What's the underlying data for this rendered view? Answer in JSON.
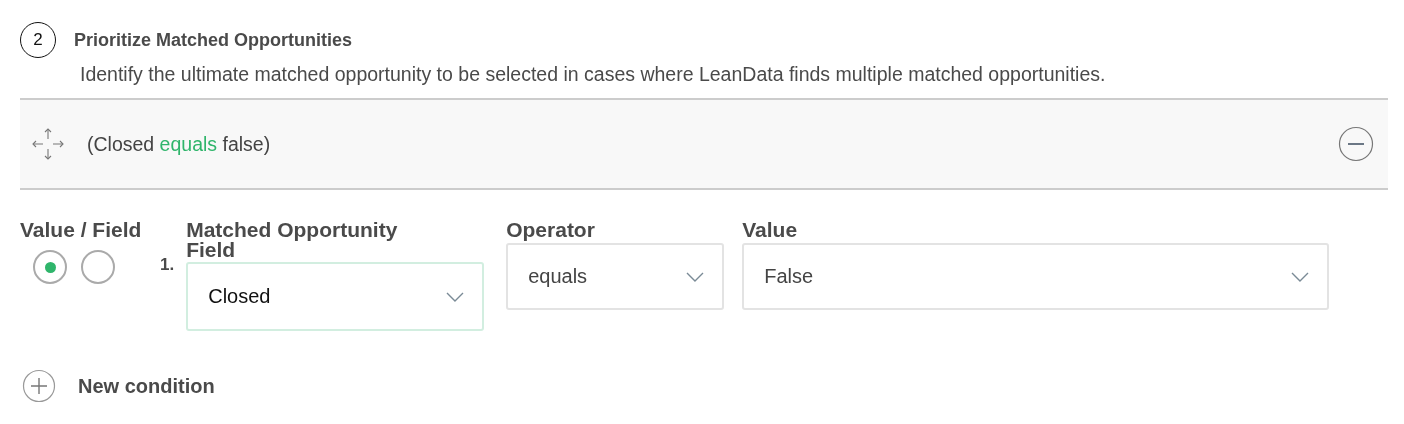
{
  "step": {
    "number": "2",
    "title": "Prioritize Matched Opportunities",
    "description": "Identify the ultimate matched opportunity to be selected in cases where LeanData finds multiple matched opportunities."
  },
  "rule": {
    "summary": [
      {
        "text": "(Closed",
        "kind": "plain"
      },
      {
        "text": "equals",
        "kind": "operator"
      },
      {
        "text": "false)",
        "kind": "plain"
      }
    ]
  },
  "condition": {
    "value_field_label": "Value / Field",
    "value_field_options": [
      {
        "selected": true
      },
      {
        "selected": false
      }
    ],
    "index": "1.",
    "field": {
      "label": "Matched Opportunity Field",
      "value": "Closed",
      "focused": true
    },
    "operator": {
      "label": "Operator",
      "value": "equals",
      "focused": false
    },
    "value": {
      "label": "Value",
      "value": "False",
      "focused": false
    }
  },
  "new_condition": "New condition"
}
